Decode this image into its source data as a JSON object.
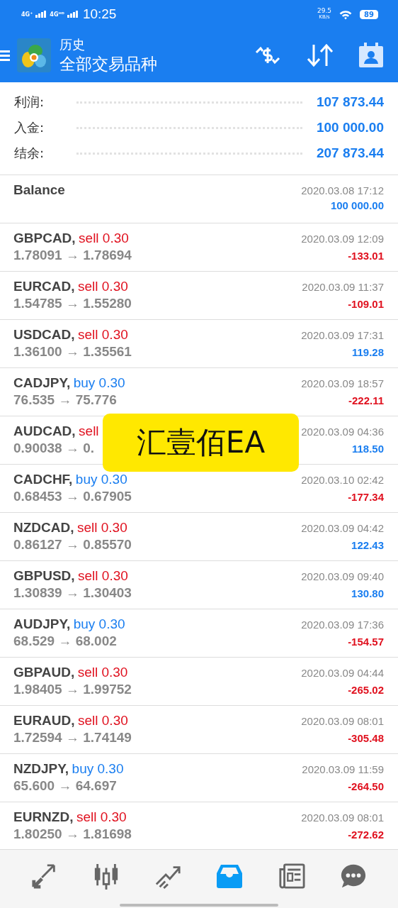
{
  "status_bar": {
    "network_1": "4G⁺",
    "network_2": "4Gᴴᴰ",
    "time": "10:25",
    "speed": "29.5",
    "speed_unit": "KB/s",
    "battery": "89"
  },
  "header": {
    "title": "历史",
    "subtitle": "全部交易品种"
  },
  "summary": [
    {
      "label": "利润:",
      "value": "107 873.44"
    },
    {
      "label": "入金:",
      "value": "100 000.00"
    },
    {
      "label": "结余:",
      "value": "207 873.44"
    }
  ],
  "balance": {
    "label": "Balance",
    "time": "2020.03.08 17:12",
    "amount": "100 000.00"
  },
  "trades": [
    {
      "symbol": "GBPCAD,",
      "is_buy": false,
      "action": "sell 0.30",
      "prices": "1.78091 → 1.78694",
      "time": "2020.03.09 12:09",
      "profit": "-133.01",
      "loss": true
    },
    {
      "symbol": "EURCAD,",
      "is_buy": false,
      "action": "sell 0.30",
      "prices": "1.54785 → 1.55280",
      "time": "2020.03.09 11:37",
      "profit": "-109.01",
      "loss": true
    },
    {
      "symbol": "USDCAD,",
      "is_buy": false,
      "action": "sell 0.30",
      "prices": "1.36100 → 1.35561",
      "time": "2020.03.09 17:31",
      "profit": "119.28",
      "loss": false
    },
    {
      "symbol": "CADJPY,",
      "is_buy": true,
      "action": "buy 0.30",
      "prices": "76.535 → 75.776",
      "time": "2020.03.09 18:57",
      "profit": "-222.11",
      "loss": true
    },
    {
      "symbol": "AUDCAD,",
      "is_buy": false,
      "action": "sell",
      "prices": "0.90038 → 0.",
      "time": "2020.03.09 04:36",
      "profit": "118.50",
      "loss": false
    },
    {
      "symbol": "CADCHF,",
      "is_buy": true,
      "action": "buy 0.30",
      "prices": "0.68453 → 0.67905",
      "time": "2020.03.10 02:42",
      "profit": "-177.34",
      "loss": true
    },
    {
      "symbol": "NZDCAD,",
      "is_buy": false,
      "action": "sell 0.30",
      "prices": "0.86127 → 0.85570",
      "time": "2020.03.09 04:42",
      "profit": "122.43",
      "loss": false
    },
    {
      "symbol": "GBPUSD,",
      "is_buy": false,
      "action": "sell 0.30",
      "prices": "1.30839 → 1.30403",
      "time": "2020.03.09 09:40",
      "profit": "130.80",
      "loss": false
    },
    {
      "symbol": "AUDJPY,",
      "is_buy": true,
      "action": "buy 0.30",
      "prices": "68.529 → 68.002",
      "time": "2020.03.09 17:36",
      "profit": "-154.57",
      "loss": true
    },
    {
      "symbol": "GBPAUD,",
      "is_buy": false,
      "action": "sell 0.30",
      "prices": "1.98405 → 1.99752",
      "time": "2020.03.09 04:44",
      "profit": "-265.02",
      "loss": true
    },
    {
      "symbol": "EURAUD,",
      "is_buy": false,
      "action": "sell 0.30",
      "prices": "1.72594 → 1.74149",
      "time": "2020.03.09 08:01",
      "profit": "-305.48",
      "loss": true
    },
    {
      "symbol": "NZDJPY,",
      "is_buy": true,
      "action": "buy 0.30",
      "prices": "65.600 → 64.697",
      "time": "2020.03.09 11:59",
      "profit": "-264.50",
      "loss": true
    },
    {
      "symbol": "EURNZD,",
      "is_buy": false,
      "action": "sell 0.30",
      "prices": "1.80250 → 1.81698",
      "time": "2020.03.09 08:01",
      "profit": "-272.62",
      "loss": true
    }
  ],
  "overlay": {
    "text": "汇壹佰EA"
  },
  "tab_bar": [
    {
      "kind": "trade",
      "selected": false
    },
    {
      "kind": "quotes",
      "selected": false
    },
    {
      "kind": "chart",
      "selected": false
    },
    {
      "kind": "history",
      "selected": true
    },
    {
      "kind": "news",
      "selected": false
    },
    {
      "kind": "chat",
      "selected": false
    }
  ]
}
